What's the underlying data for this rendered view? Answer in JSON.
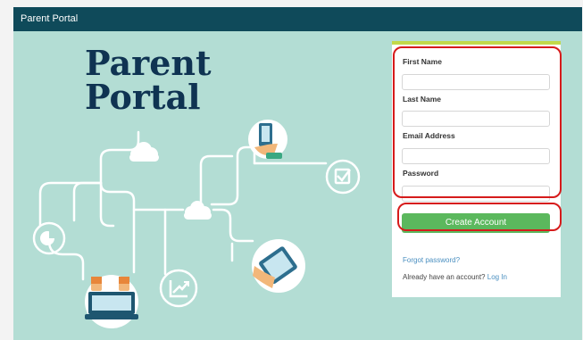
{
  "header": {
    "title": "Parent Portal"
  },
  "hero": {
    "title_line1": "Parent",
    "title_line2": "Portal"
  },
  "form": {
    "first_name_label": "First Name",
    "first_name_value": "",
    "last_name_label": "Last Name",
    "last_name_value": "",
    "email_label": "Email Address",
    "email_value": "",
    "password_label": "Password",
    "password_value": "",
    "create_button": "Create Account",
    "forgot_link": "Forgot password?",
    "already_text": "Already have an account?",
    "login_link": "Log In"
  },
  "colors": {
    "background": "#b3ddd4",
    "header_bar": "#0f4a5a",
    "title_text": "#0f3352",
    "panel_accent": "#c2d94a",
    "button": "#5bb85d",
    "highlight": "#d61b1b",
    "link": "#4a8fc0"
  },
  "icons": [
    "pie-chart-icon",
    "phone-hand-icon",
    "cloud-icon",
    "checkbox-icon",
    "tablet-hand-icon",
    "growth-chart-icon",
    "laptop-hands-icon"
  ]
}
